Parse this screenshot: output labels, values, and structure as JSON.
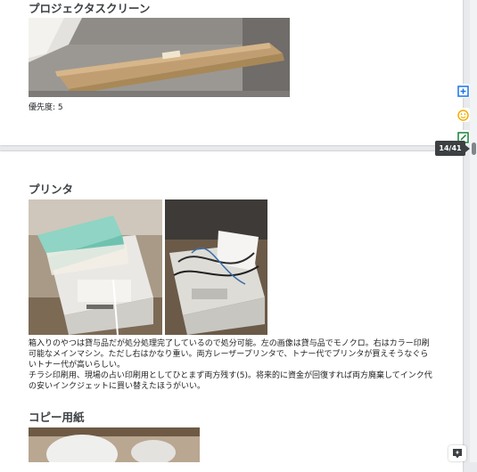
{
  "doc": {
    "section_screen": {
      "title": "プロジェクタスクリーン",
      "priority": "優先度: 5"
    },
    "section_printer": {
      "title": "プリンタ",
      "paragraph1": "箱入りのやつは貸与品だが処分処理完了しているので処分可能。左の画像は貸与品でモノクロ。右はカラー印刷可能なメインマシン。ただし右はかなり重い。両方レーザープリンタで、トナー代でプリンタが買えそうなぐらいトナー代が高いらしい。",
      "paragraph2": "チラシ印刷用、現場の占い印刷用としてひとまず両方残す(5)。将来的に資金が回復すれば両方廃棄してインク代の安いインクジェットに買い替えたほうがいい。"
    },
    "section_paper": {
      "title": "コピー用紙"
    }
  },
  "sidebar": {
    "icons": [
      "add-comment-icon",
      "emoji-icon",
      "suggest-edit-icon"
    ],
    "page_indicator": "14/41"
  },
  "colors": {
    "accent_blue": "#1a73e8",
    "emoji_yellow": "#f9ab00",
    "edit_green": "#188038"
  }
}
